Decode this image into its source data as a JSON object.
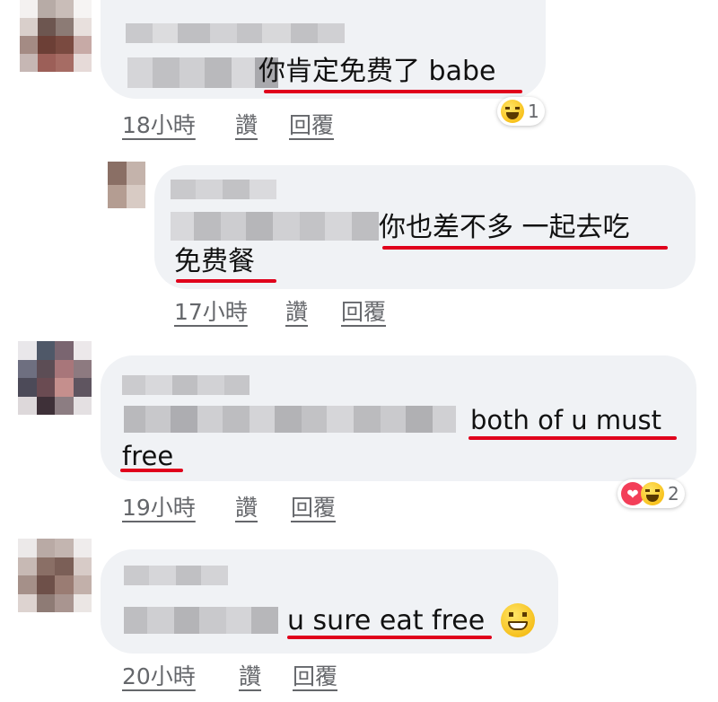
{
  "actions": {
    "like": "讚",
    "reply": "回覆"
  },
  "comments": [
    {
      "text": "你肯定免费了 babe",
      "time": "18小時",
      "reaction_count": "1",
      "reactions": [
        "laugh-emoji"
      ]
    },
    {
      "text_line1": "你也差不多 一起去吃",
      "text_line2": "免费餐",
      "time": "17小時"
    },
    {
      "text_line1": "both of u must",
      "text_line2": "free",
      "time": "19小時",
      "reaction_count": "2",
      "reactions": [
        "love-emoji",
        "laugh-emoji"
      ]
    },
    {
      "text": "u sure eat free",
      "emoji": "grin-emoji",
      "time": "20小時"
    }
  ],
  "colors": {
    "bubble": "#f0f2f5",
    "underline": "#e0001b",
    "meta": "#65676b"
  }
}
